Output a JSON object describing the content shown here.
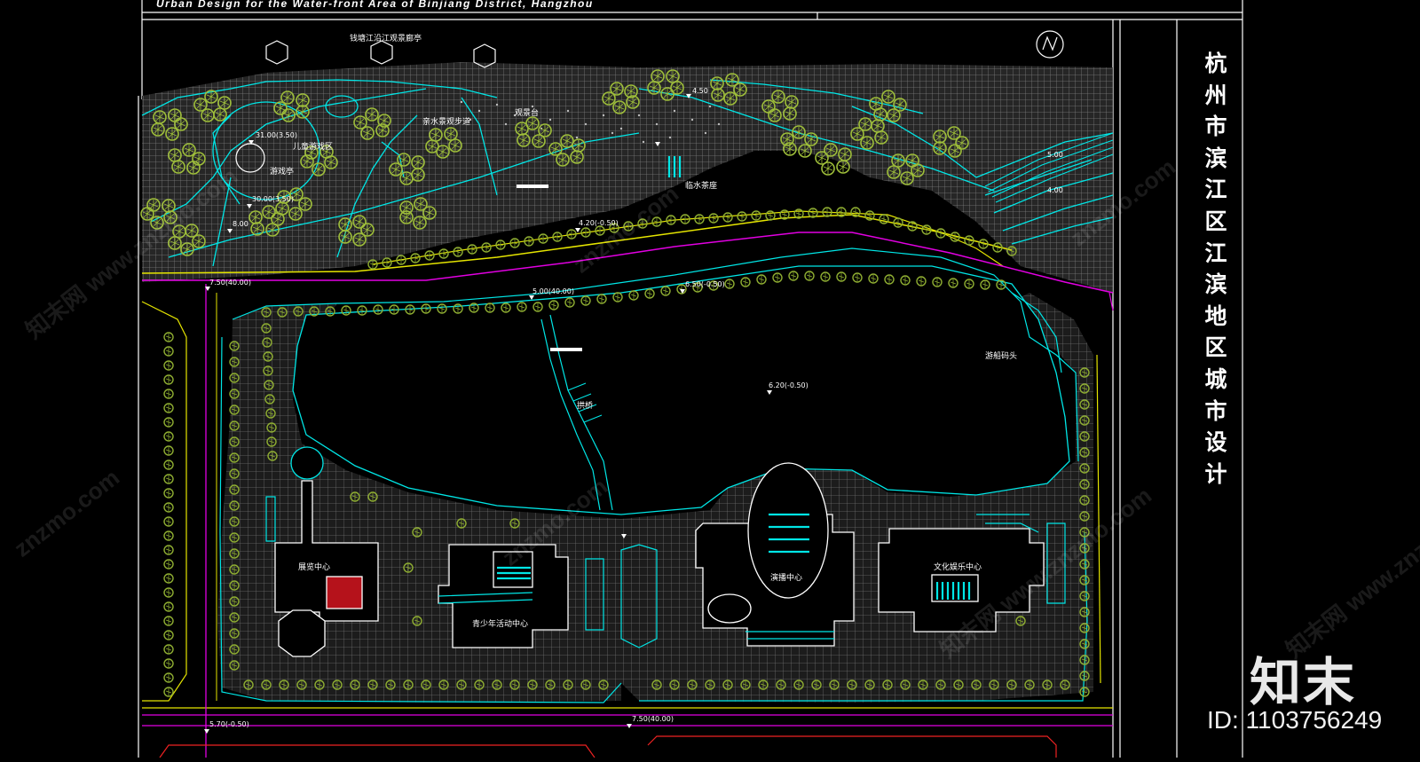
{
  "header": {
    "title": "Urban  Design  for  the  Water-front Area of Binjiang District, Hangzhou"
  },
  "vertical_title": [
    "杭",
    "州",
    "市",
    "滨",
    "江",
    "区",
    "江",
    "滨",
    "地",
    "区",
    "城",
    "市",
    "设",
    "计"
  ],
  "brand": {
    "logo_text": "知末",
    "id_label": "ID: 1103756249"
  },
  "watermarks": [
    "znzmo.com",
    "知末网 www.znzmo.com"
  ],
  "plan_labels": {
    "riverside_gate": "钱塘江沿江观景廊亭",
    "children_area": "儿童游戏区",
    "pavilion": "游戏亭",
    "waterside_path": "亲水景观步道",
    "plaza": "观景台",
    "teahouse": "临水茶座",
    "bridge": "拱桥",
    "dock": "游船码头",
    "exhibition_center": "展览中心",
    "youth_center": "青少年活动中心",
    "performance_center": "演播中心",
    "culture_center": "文化娱乐中心"
  },
  "elevations": {
    "e1": "31.00(3.50)",
    "e2": "30.00(3.50)",
    "e3": "8.00",
    "e4": "7.50(40.00)",
    "e5": "5.00(40.00)",
    "e6": "4.20(-0.50)",
    "e7": "6.50(-0.50)",
    "e8": "7.50(40.00)",
    "e9": "6.20(-0.50)",
    "e10": "5.70(-0.50)",
    "e11": "5.00",
    "e12": "4.00",
    "e13": "4.50"
  },
  "colors": {
    "background": "#000000",
    "paving": "#8a8a8a",
    "path_cyan": "#00e6e6",
    "tree_green": "#9fbf3a",
    "road_magenta": "#e200e2",
    "road_yellow": "#e5e500",
    "building_white": "#ffffff",
    "accent_red": "#b5121b"
  }
}
